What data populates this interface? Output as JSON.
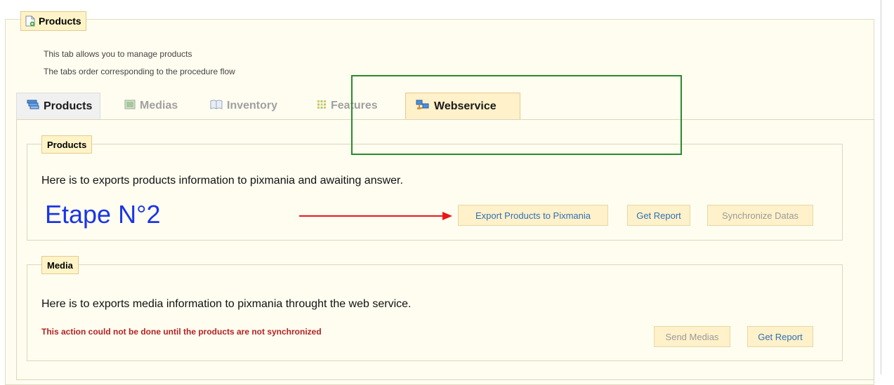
{
  "outer": {
    "legend": "Products",
    "desc_lines": [
      "This tab allows you to manage products",
      "The tabs order corresponding to the procedure flow"
    ]
  },
  "tabs": [
    {
      "label": "Products",
      "icon": "products-icon",
      "state": "normal"
    },
    {
      "label": "Medias",
      "icon": "image-icon",
      "state": "inactive"
    },
    {
      "label": "Inventory",
      "icon": "book-icon",
      "state": "inactive"
    },
    {
      "label": "Features",
      "icon": "grid-icon",
      "state": "inactive"
    },
    {
      "label": "Webservice",
      "icon": "webservice-icon",
      "state": "active"
    }
  ],
  "products_section": {
    "legend": "Products",
    "text": "Here is to exports products information to pixmania and awaiting answer.",
    "buttons": {
      "export": "Export Products to Pixmania",
      "report": "Get Report",
      "sync": "Synchronize Datas"
    }
  },
  "media_section": {
    "legend": "Media",
    "text": "Here is to exports media information to pixmania throught the web service.",
    "warning": "This action could not be done until the products are not synchronized",
    "buttons": {
      "send": "Send Medias",
      "report": "Get Report"
    }
  },
  "annotation": {
    "etape": "Etape N°2"
  },
  "colors": {
    "panel_bg": "#fffdf0",
    "legend_bg": "#fff4c8",
    "link_blue": "#2e6fb7",
    "warning_red": "#b22222",
    "etape_blue": "#1a36e6",
    "arrow_red": "#e81818",
    "highlight_green": "#2a8a2a"
  }
}
